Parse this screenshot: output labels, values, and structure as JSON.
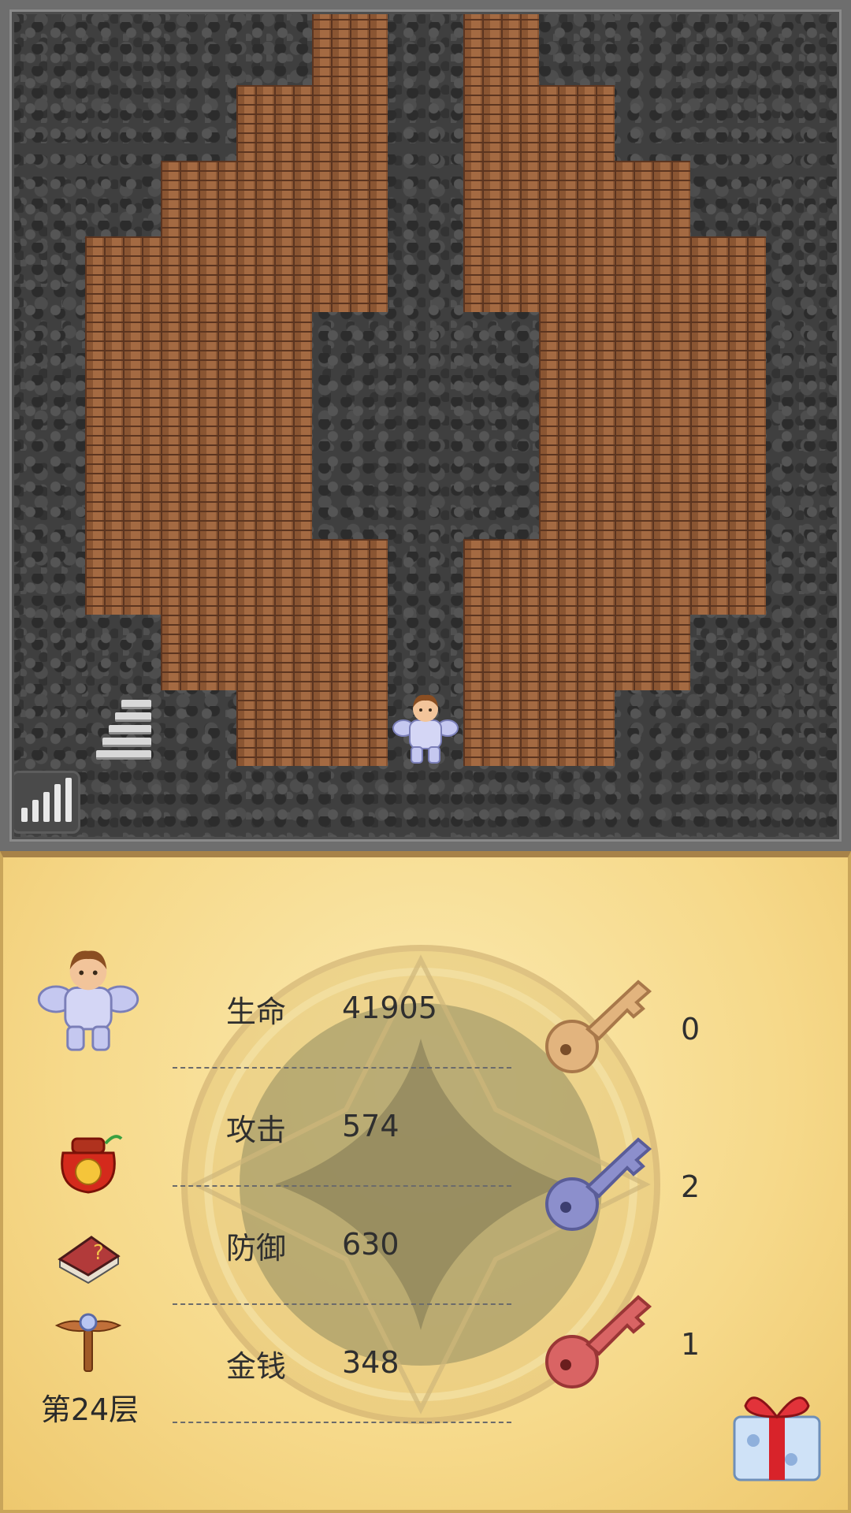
{
  "stats": [
    {
      "label": "生命",
      "value": "41905"
    },
    {
      "label": "攻击",
      "value": "574"
    },
    {
      "label": "防御",
      "value": "630"
    },
    {
      "label": "金钱",
      "value": "348"
    }
  ],
  "keys": [
    {
      "name": "yellow-key",
      "color": "#e2b47e",
      "count": "0"
    },
    {
      "name": "blue-key",
      "color": "#8c8fcc",
      "count": "2"
    },
    {
      "name": "red-key",
      "color": "#d96464",
      "count": "1"
    }
  ],
  "floor": {
    "label": "第24层"
  },
  "colors": {
    "wall": "#3f3f3f",
    "brick": "#8a5532",
    "panel": "#f6d98a"
  },
  "icons": {
    "hero": "hero-portrait",
    "bag": "lucky-bag-icon",
    "book": "monster-book-icon",
    "wand": "fly-wand-icon",
    "stairs": "stairs-down-icon",
    "signal": "signal-bars-icon",
    "gift": "gift-box-icon"
  }
}
